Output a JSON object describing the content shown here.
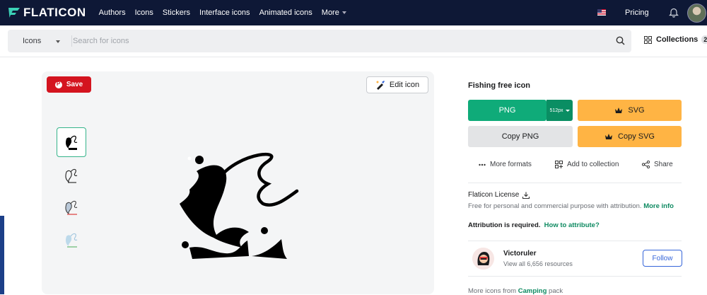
{
  "topbar": {
    "logo": "FLATICON",
    "nav": [
      "Authors",
      "Icons",
      "Stickers",
      "Interface icons",
      "Animated icons",
      "More"
    ],
    "pricing": "Pricing"
  },
  "search": {
    "type_label": "Icons",
    "placeholder": "Search for icons",
    "collections_label": "Collections",
    "collections_count": "2"
  },
  "preview": {
    "save_label": "Save",
    "edit_label": "Edit icon"
  },
  "detail": {
    "title": "Fishing free icon",
    "png_label": "PNG",
    "png_size": "512px",
    "svg_label": "SVG",
    "copy_png_label": "Copy PNG",
    "copy_svg_label": "Copy SVG",
    "more_formats": "More formats",
    "add_collection": "Add to collection",
    "share": "Share"
  },
  "license": {
    "title": "Flaticon License",
    "text": "Free for personal and commercial purpose with attribution.",
    "more_info": "More info",
    "attribution": "Attribution is required.",
    "how_to": "How to attribute?"
  },
  "author": {
    "name": "Victoruler",
    "resources": "View all 6,656 resources",
    "follow": "Follow"
  },
  "more_pack": {
    "prefix": "More icons from",
    "pack": "Camping",
    "suffix": "pack"
  },
  "colors": {
    "nav_bg": "#0e1836",
    "png_green": "#0fab79",
    "svg_yellow": "#ffb444",
    "save_red": "#d4141f",
    "link_green": "#0e8a61",
    "follow_blue": "#3565d9"
  }
}
